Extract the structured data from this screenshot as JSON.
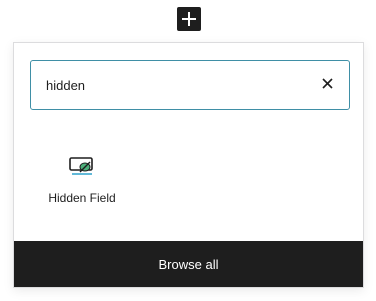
{
  "toolbar": {
    "add_icon": "plus-icon",
    "add_bg_color": "#1e1e1e"
  },
  "search": {
    "value": "hidden",
    "clear_icon": "close-icon",
    "border_color": "#3f8fa6"
  },
  "results": {
    "items": [
      {
        "label": "Hidden Field",
        "icon": "hidden-field-icon",
        "icon_accent": "#2ea2cc"
      }
    ]
  },
  "footer": {
    "browse_all_label": "Browse all"
  }
}
